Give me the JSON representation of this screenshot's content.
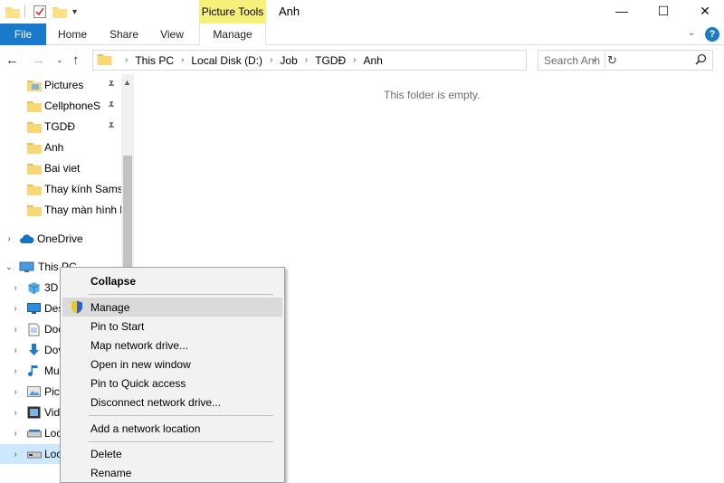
{
  "window": {
    "title": "Anh",
    "contextual_tab_group": "Picture Tools",
    "minimize_glyph": "—",
    "maximize_glyph": "☐",
    "close_glyph": "✕",
    "dropdown_glyph": "▾"
  },
  "ribbon": {
    "tabs": [
      {
        "label": "File"
      },
      {
        "label": "Home"
      },
      {
        "label": "Share"
      },
      {
        "label": "View"
      },
      {
        "label": "Manage"
      }
    ],
    "expand_glyph": "⌄",
    "help_glyph": "?"
  },
  "navbar": {
    "back_glyph": "←",
    "forward_glyph": "→",
    "recent_glyph": "⌄",
    "up_glyph": "↑",
    "breadcrumb": [
      "This PC",
      "Local Disk (D:)",
      "Job",
      "TGDĐ",
      "Anh"
    ],
    "separator_glyph": "›",
    "dropdown_glyph": "⌄",
    "refresh_glyph": "↻",
    "search_placeholder": "Search Anh",
    "search_value": "",
    "search_glyph": "⚲"
  },
  "navpane": {
    "scroll_up_glyph": "▲",
    "quick_access": [
      {
        "label": "Pictures",
        "icon": "pictures-folder-icon",
        "pinned": true
      },
      {
        "label": "CellphoneS",
        "icon": "folder-icon",
        "pinned": true
      },
      {
        "label": "TGDĐ",
        "icon": "folder-icon",
        "pinned": true
      },
      {
        "label": "Anh",
        "icon": "folder-icon",
        "pinned": false
      },
      {
        "label": "Bai viet",
        "icon": "folder-icon",
        "pinned": false
      },
      {
        "label": "Thay kính Samsu",
        "icon": "folder-icon",
        "pinned": false
      },
      {
        "label": "Thay màn hình k",
        "icon": "folder-icon",
        "pinned": false
      }
    ],
    "pin_glyph": "📌",
    "onedrive": {
      "label": "OneDrive",
      "icon": "onedrive-icon"
    },
    "this_pc": {
      "label": "This PC",
      "icon": "computer-icon"
    },
    "this_pc_children": [
      {
        "label": "3D",
        "icon": "3d-objects-icon"
      },
      {
        "label": "Des",
        "icon": "desktop-icon"
      },
      {
        "label": "Doc",
        "icon": "documents-icon"
      },
      {
        "label": "Dov",
        "icon": "downloads-icon"
      },
      {
        "label": "Mu",
        "icon": "music-icon"
      },
      {
        "label": "Pict",
        "icon": "pictures-icon"
      },
      {
        "label": "Vid",
        "icon": "videos-icon"
      },
      {
        "label": "Loc",
        "icon": "drive-icon"
      },
      {
        "label": "Loc",
        "icon": "drive-icon"
      }
    ],
    "chevron_right": "›",
    "chevron_down": "⌄"
  },
  "content": {
    "empty_message": "This folder is empty."
  },
  "context_menu": {
    "items": [
      {
        "label": "Collapse",
        "bold": true
      },
      {
        "label": "Manage",
        "icon": "uac-shield-icon",
        "hover": true
      },
      {
        "label": "Pin to Start"
      },
      {
        "label": "Map network drive..."
      },
      {
        "label": "Open in new window"
      },
      {
        "label": "Pin to Quick access"
      },
      {
        "label": "Disconnect network drive..."
      },
      {
        "label": "Add a network location"
      },
      {
        "label": "Delete"
      },
      {
        "label": "Rename"
      }
    ]
  },
  "colors": {
    "file_tab": "#1979ca",
    "contextual_tab": "#f7f07a",
    "selected_item": "#cce8ff",
    "menu_background": "#f2f2f2",
    "menu_hover": "#dadada",
    "folder_yellow": "#f8d775"
  }
}
